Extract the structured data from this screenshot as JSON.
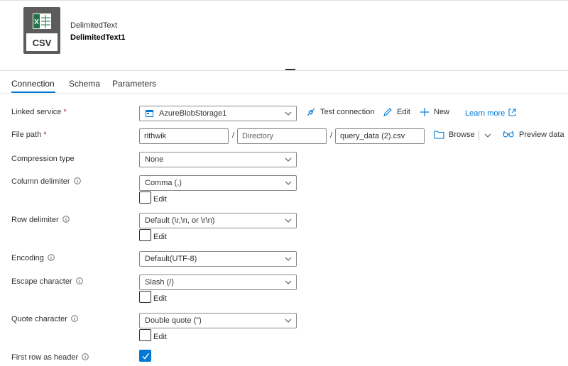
{
  "dataset": {
    "type": "DelimitedText",
    "name": "DelimitedText1",
    "icon": "csv-file-icon",
    "icon_text": "CSV"
  },
  "tabs": [
    {
      "label": "Connection",
      "active": true
    },
    {
      "label": "Schema",
      "active": false
    },
    {
      "label": "Parameters",
      "active": false
    }
  ],
  "linked_service": {
    "label": "Linked service",
    "required_mark": "*",
    "value": "AzureBlobStorage1",
    "test_connection": "Test connection",
    "edit": "Edit",
    "new": "New",
    "learn_more": "Learn more"
  },
  "file_path": {
    "label": "File path",
    "required_mark": "*",
    "container": "rithwik",
    "directory_placeholder": "Directory",
    "file": "query_data (2).csv",
    "separator": "/",
    "browse": "Browse",
    "preview": "Preview data"
  },
  "compression_type": {
    "label": "Compression type",
    "value": "None"
  },
  "column_delimiter": {
    "label": "Column delimiter",
    "value": "Comma (,)",
    "edit_label": "Edit",
    "edit_checked": false
  },
  "row_delimiter": {
    "label": "Row delimiter",
    "value": "Default (\\r,\\n, or \\r\\n)",
    "edit_label": "Edit",
    "edit_checked": false
  },
  "encoding": {
    "label": "Encoding",
    "value": "Default(UTF-8)"
  },
  "escape_character": {
    "label": "Escape character",
    "value": "Slash (/)",
    "edit_label": "Edit",
    "edit_checked": false
  },
  "quote_character": {
    "label": "Quote character",
    "value": "Double quote (\")",
    "edit_label": "Edit",
    "edit_checked": false
  },
  "first_row_header": {
    "label": "First row as header",
    "checked": true
  },
  "colors": {
    "accent": "#0078d4",
    "required": "#a4262c",
    "excel_green": "#217346",
    "icon_gray": "#5c5c5c"
  }
}
